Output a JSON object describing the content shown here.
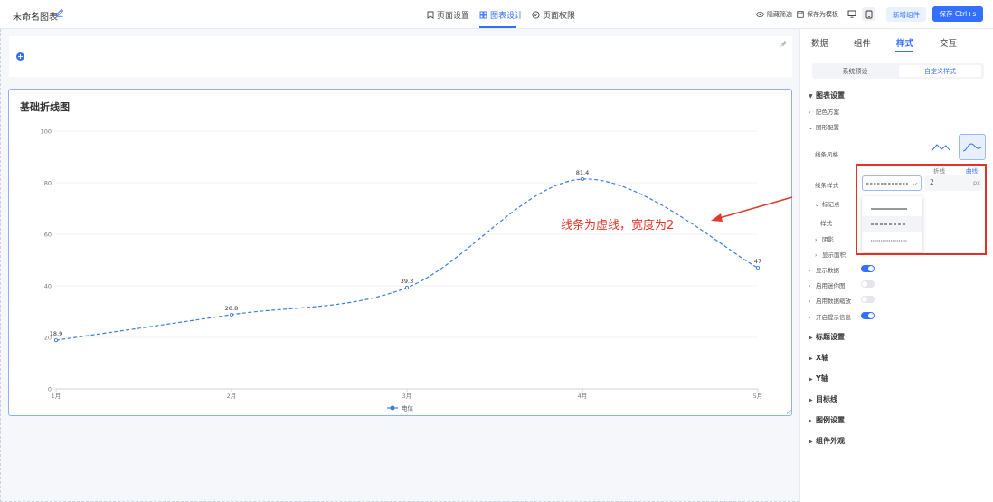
{
  "header": {
    "title": "未命名图表",
    "tabs": [
      {
        "label": "页面设置",
        "icon": "bookmark-icon"
      },
      {
        "label": "图表设计",
        "icon": "design-grid-icon",
        "active": true
      },
      {
        "label": "页面权限",
        "icon": "shield-check-icon"
      }
    ],
    "hide_filter": "隐藏筛选",
    "save_template": "保存为模板",
    "new_component": "新增组件",
    "save": "保存 Ctrl+s"
  },
  "chart_card": {
    "title": "基础折线图"
  },
  "chart_data": {
    "type": "line",
    "categories": [
      "1月",
      "2月",
      "3月",
      "4月",
      "5月"
    ],
    "series": [
      {
        "name": "电信",
        "values": [
          18.9,
          28.8,
          39.3,
          81.4,
          47
        ],
        "color": "#3b7ddd",
        "dashed": true,
        "smooth": true
      }
    ],
    "yticks": [
      0,
      20,
      40,
      60,
      80,
      100
    ],
    "ylim": [
      0,
      100
    ],
    "legend_position": "bottom",
    "grid": true
  },
  "annotation": {
    "text": "线条为虚线，宽度为2",
    "color": "#e03a2c"
  },
  "panel": {
    "tabs": [
      "数据",
      "组件",
      "样式",
      "交互"
    ],
    "active_tab": "样式",
    "segments": [
      "系统预设",
      "自定义样式"
    ],
    "active_segment": "自定义样式",
    "chart_settings": "图表设置",
    "color_scheme": "配色方案",
    "shape_config": "图形配置",
    "line_style_label": "线条风格",
    "line_style_options": [
      "折线",
      "曲线"
    ],
    "active_line_style": "曲线",
    "line_type_label": "线条样式",
    "line_width": "2",
    "line_width_unit": "px",
    "marker": "标记点",
    "marker_style": "样式",
    "shadow": "阴影",
    "show_area": "显示面积",
    "toggles": [
      {
        "label": "显示数据",
        "on": true
      },
      {
        "label": "启用迷你图",
        "on": false
      },
      {
        "label": "启用数据缩放",
        "on": false
      },
      {
        "label": "开启提示信息",
        "on": true
      }
    ],
    "sections": [
      "标题设置",
      "X轴",
      "Y轴",
      "目标线",
      "图例设置",
      "组件外观"
    ]
  },
  "colors": {
    "accent": "#3370ff",
    "highlight": "#e3312a"
  }
}
